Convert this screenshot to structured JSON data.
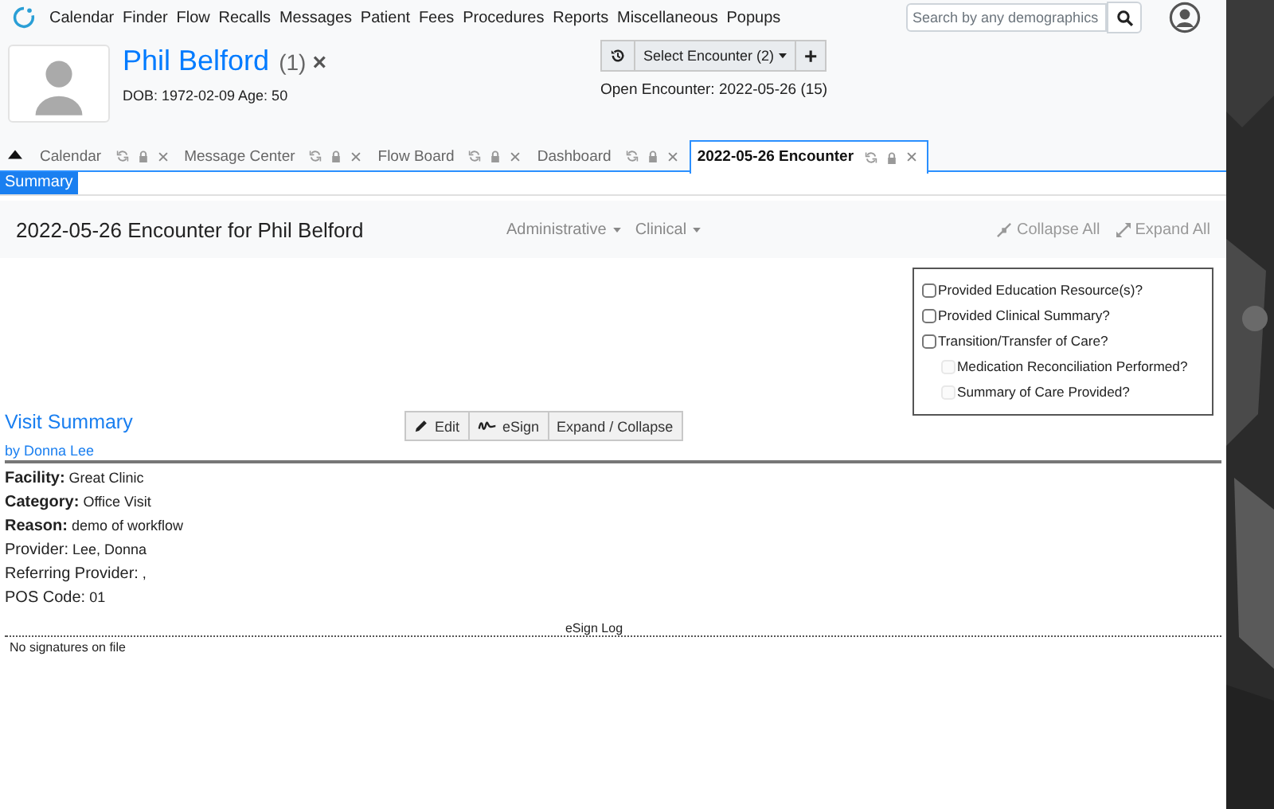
{
  "nav": {
    "menu": [
      "Calendar",
      "Finder",
      "Flow",
      "Recalls",
      "Messages",
      "Patient",
      "Fees",
      "Procedures",
      "Reports",
      "Miscellaneous",
      "Popups"
    ],
    "search": {
      "placeholder": "Search by any demographics"
    }
  },
  "patient": {
    "name": "Phil Belford",
    "count": "(1)",
    "close": "×",
    "dob": "DOB: 1972-02-09 Age: 50"
  },
  "encounter_bar": {
    "select_label": "Select Encounter",
    "select_count": "(2)",
    "add": "+",
    "open_encounter": "Open Encounter: 2022-05-26 (15)"
  },
  "tabs": [
    {
      "label": "Calendar",
      "selected": false
    },
    {
      "label": "Message Center",
      "selected": false
    },
    {
      "label": "Flow Board",
      "selected": false
    },
    {
      "label": "Dashboard",
      "selected": false
    },
    {
      "label": "2022-05-26 Encounter",
      "selected": true
    }
  ],
  "subtabs": [
    {
      "label": "Summary",
      "selected": true
    }
  ],
  "encounter": {
    "title": "2022-05-26 Encounter for Phil Belford",
    "menus": [
      "Administrative",
      "Clinical"
    ],
    "actions": [
      {
        "label": "Collapse All",
        "kind": "collapse"
      },
      {
        "label": "Expand All",
        "kind": "expand"
      }
    ]
  },
  "checklist": [
    {
      "label": "Provided Education Resource(s)?",
      "checked": false,
      "disabled": false
    },
    {
      "label": "Provided Clinical Summary?",
      "checked": false,
      "disabled": false
    },
    {
      "label": "Transition/Transfer of Care?",
      "checked": false,
      "disabled": false,
      "children": [
        {
          "label": "Medication Reconciliation Performed?",
          "checked": false,
          "disabled": true
        },
        {
          "label": "Summary of Care Provided?",
          "checked": false,
          "disabled": true
        }
      ]
    }
  ],
  "visit_summary": {
    "title": "Visit Summary",
    "author": "by Donna Lee",
    "buttons": [
      {
        "label": "Edit",
        "kind": "edit"
      },
      {
        "label": "eSign",
        "kind": "esign"
      },
      {
        "label": "Expand / Collapse",
        "kind": "plain"
      }
    ],
    "fields": [
      {
        "label": "Facility:",
        "value": "Great Clinic",
        "kind": "bold"
      },
      {
        "label": "Category:",
        "value": "Office Visit",
        "kind": "bold"
      },
      {
        "label": "Reason:",
        "value": "demo of workflow",
        "kind": "bold"
      },
      {
        "label": "Provider:",
        "value": "Lee, Donna",
        "kind": "plain"
      },
      {
        "label": "Referring Provider:",
        "value": ",",
        "kind": "plain"
      },
      {
        "label": "POS Code:",
        "value": "01",
        "kind": "plain"
      }
    ]
  },
  "esign_log": {
    "title": "eSign Log",
    "entries": [
      "No signatures on file"
    ]
  }
}
